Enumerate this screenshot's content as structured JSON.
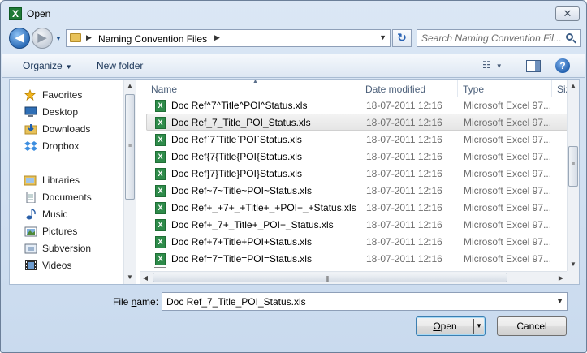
{
  "window": {
    "title": "Open",
    "close_glyph": "✕",
    "app_icon_letter": "X"
  },
  "nav": {
    "back_glyph": "◀",
    "forward_glyph": "▶",
    "recent_glyph": "▼",
    "refresh_glyph": "↻"
  },
  "address": {
    "path_item": "Naming Convention Files",
    "sep_glyph": "▶",
    "drop_glyph": "▼"
  },
  "search": {
    "placeholder": "Search Naming Convention Fil..."
  },
  "toolbar": {
    "organize_label": "Organize",
    "new_folder_label": "New folder",
    "caret_glyph": "▼",
    "views_glyph": "☷",
    "help_glyph": "?"
  },
  "navigation_pane": {
    "favorites_label": "Favorites",
    "favorites": [
      {
        "label": "Desktop",
        "icon": "desktop-icon"
      },
      {
        "label": "Downloads",
        "icon": "downloads-icon"
      },
      {
        "label": "Dropbox",
        "icon": "dropbox-icon"
      }
    ],
    "libraries_label": "Libraries",
    "libraries": [
      {
        "label": "Documents",
        "icon": "documents-icon"
      },
      {
        "label": "Music",
        "icon": "music-icon"
      },
      {
        "label": "Pictures",
        "icon": "pictures-icon"
      },
      {
        "label": "Subversion",
        "icon": "subversion-icon"
      },
      {
        "label": "Videos",
        "icon": "videos-icon"
      }
    ]
  },
  "file_list": {
    "columns": [
      "Name",
      "Date modified",
      "Type",
      "Siz"
    ],
    "rows": [
      {
        "name": "Doc Ref^7^Title^POI^Status.xls",
        "date": "18-07-2011 12:16",
        "type": "Microsoft Excel 97..."
      },
      {
        "name": "Doc Ref_7_Title_POI_Status.xls",
        "date": "18-07-2011 12:16",
        "type": "Microsoft Excel 97...",
        "selected": true
      },
      {
        "name": "Doc Ref`7`Title`POI`Status.xls",
        "date": "18-07-2011 12:16",
        "type": "Microsoft Excel 97..."
      },
      {
        "name": "Doc Ref{7{Title{POI{Status.xls",
        "date": "18-07-2011 12:16",
        "type": "Microsoft Excel 97..."
      },
      {
        "name": "Doc Ref}7}Title}POI}Status.xls",
        "date": "18-07-2011 12:16",
        "type": "Microsoft Excel 97..."
      },
      {
        "name": "Doc Ref~7~Title~POI~Status.xls",
        "date": "18-07-2011 12:16",
        "type": "Microsoft Excel 97..."
      },
      {
        "name": "Doc Ref+_+7+_+Title+_+POI+_+Status.xls",
        "date": "18-07-2011 12:16",
        "type": "Microsoft Excel 97..."
      },
      {
        "name": "Doc Ref+_7+_Title+_POI+_Status.xls",
        "date": "18-07-2011 12:16",
        "type": "Microsoft Excel 97..."
      },
      {
        "name": "Doc Ref+7+Title+POI+Status.xls",
        "date": "18-07-2011 12:16",
        "type": "Microsoft Excel 97..."
      },
      {
        "name": "Doc Ref=7=Title=POI=Status.xls",
        "date": "18-07-2011 12:16",
        "type": "Microsoft Excel 97..."
      }
    ]
  },
  "bottom": {
    "file_name_label_prefix": "File ",
    "file_name_label_accel": "n",
    "file_name_label_suffix": "ame:",
    "file_name_value": "Doc Ref_7_Title_POI_Status.xls",
    "open_accel": "O",
    "open_rest": "pen",
    "cancel_label": "Cancel"
  },
  "colors": {
    "accent": "#2d6db8",
    "title_bg": "#dbe7f5",
    "selection": "#e5e5e5",
    "excel_green": "#2e8b4a"
  }
}
